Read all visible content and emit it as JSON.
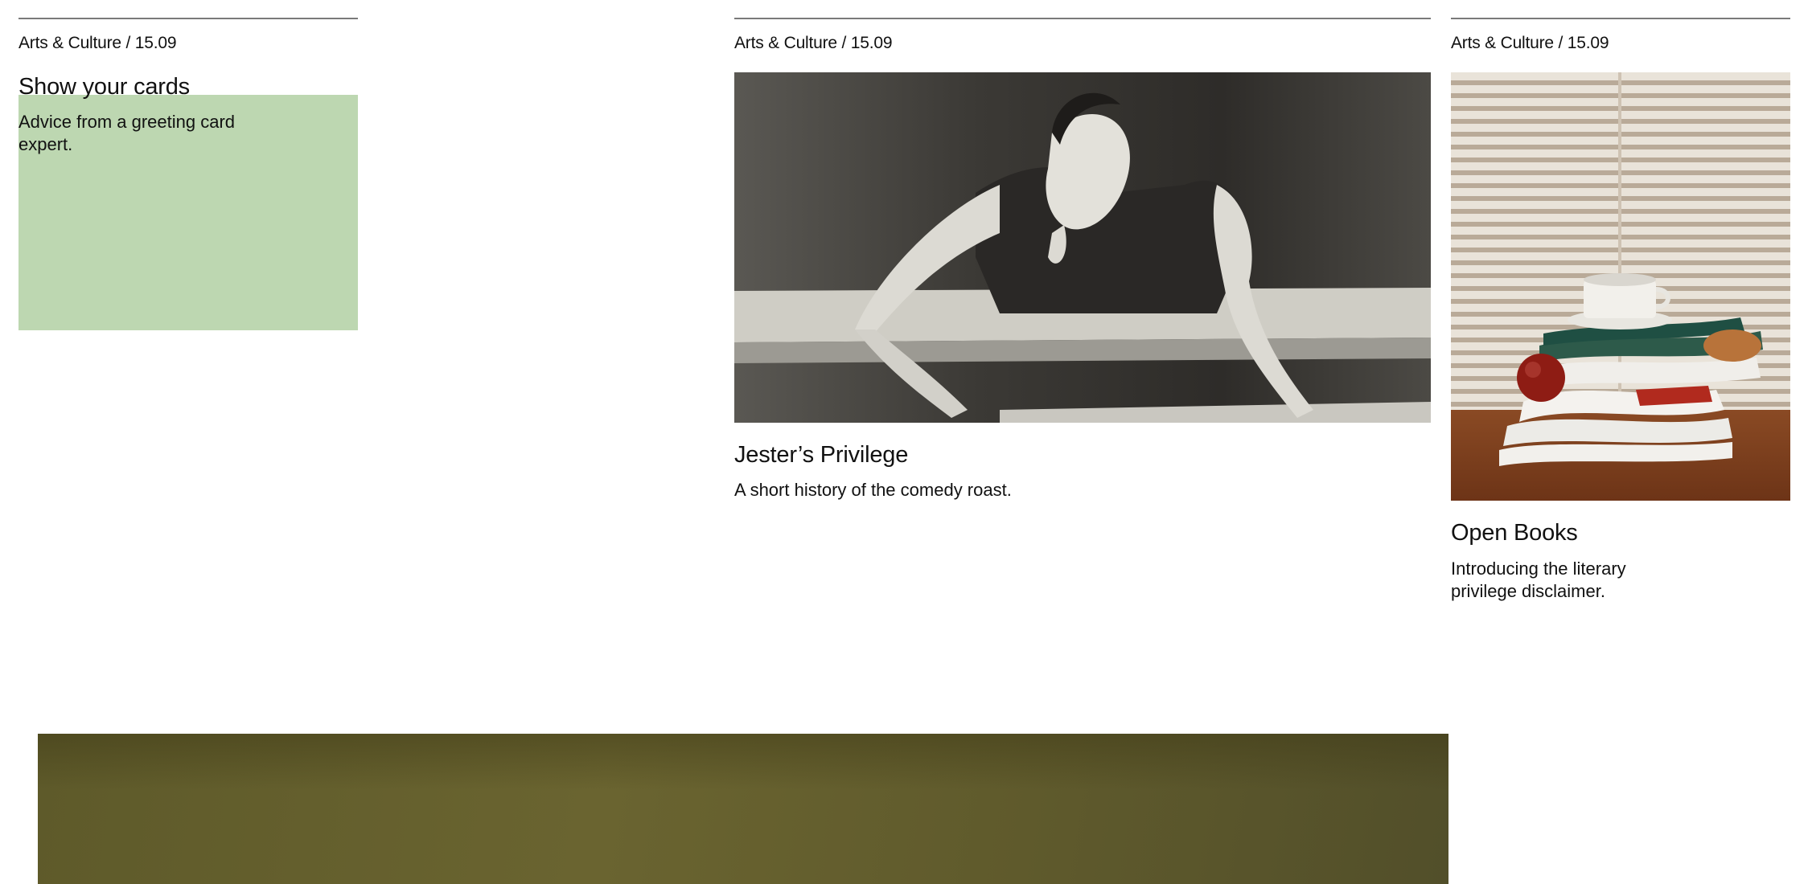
{
  "cards": [
    {
      "meta": "Arts & Culture / 15.09",
      "title": "Show your cards",
      "description": "Advice from a greeting card expert.",
      "swatch_color": "#bdd7b1"
    },
    {
      "meta": "Arts & Culture / 15.09",
      "title": "Jester’s Privilege",
      "description": "A short history of the comedy roast.",
      "image": "black-and-white-photo-woman-leaning-over-railing"
    },
    {
      "meta": "Arts & Culture / 15.09",
      "title": "Open Books",
      "description": "Introducing the literary privilege disclaimer.",
      "image": "stack-of-books-with-teacup-and-apple-before-blinds"
    }
  ],
  "hero": {
    "image": "olive-green-photo",
    "color": "#655f2e"
  }
}
